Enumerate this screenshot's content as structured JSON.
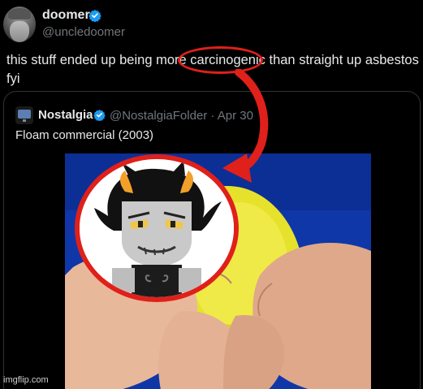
{
  "author": {
    "display_name": "doomer",
    "handle": "@uncledoomer"
  },
  "tweet": {
    "text_before": "this stuff ended up being more ",
    "highlighted_word": "carcinogenic",
    "text_after": " than straight up asbestos",
    "text_line2": "fyi"
  },
  "quoted_tweet": {
    "display_name": "Nostalgia",
    "handle_and_date": "@NostalgiaFolder · Apr 30",
    "text": "Floam commercial (2003)"
  },
  "watermark": "imgflip.com",
  "colors": {
    "background": "#000000",
    "text": "#e7e9ea",
    "muted": "#71767b",
    "verified": "#1d9bf0",
    "annotation_red": "#e0201a",
    "floam_yellow": "#e6e22c",
    "video_blue": "#0f37a8"
  },
  "icons": {
    "verified": "verified-badge-icon",
    "annotation": "red-arrow-icon"
  }
}
